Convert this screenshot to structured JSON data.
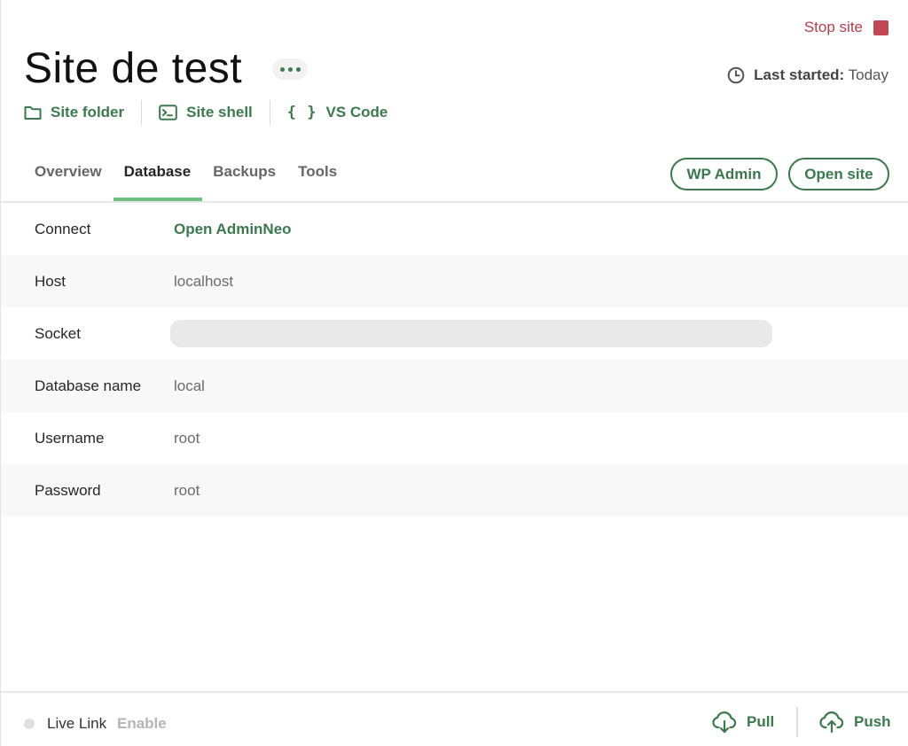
{
  "header": {
    "stop_site_label": "Stop site",
    "site_title": "Site de test",
    "last_started_label": "Last started:",
    "last_started_value": "Today"
  },
  "quick_links": {
    "site_folder": "Site folder",
    "site_shell": "Site shell",
    "vs_code_icon_text": "{ }",
    "vs_code": "VS Code"
  },
  "tabs": [
    {
      "label": "Overview",
      "active": false
    },
    {
      "label": "Database",
      "active": true
    },
    {
      "label": "Backups",
      "active": false
    },
    {
      "label": "Tools",
      "active": false
    }
  ],
  "actions": {
    "wp_admin": "WP Admin",
    "open_site": "Open site"
  },
  "database": {
    "rows": [
      {
        "key": "Connect",
        "value": "Open AdminNeo"
      },
      {
        "key": "Host",
        "value": "localhost"
      },
      {
        "key": "Socket",
        "value": ""
      },
      {
        "key": "Database name",
        "value": "local"
      },
      {
        "key": "Username",
        "value": "root"
      },
      {
        "key": "Password",
        "value": "root"
      }
    ]
  },
  "footer": {
    "live_link_label": "Live Link",
    "live_link_enable": "Enable",
    "pull_label": "Pull",
    "push_label": "Push"
  },
  "colors": {
    "accent_green": "#3a7a4c",
    "tab_underline": "#6bbf7f",
    "stop_red": "#c14955"
  }
}
